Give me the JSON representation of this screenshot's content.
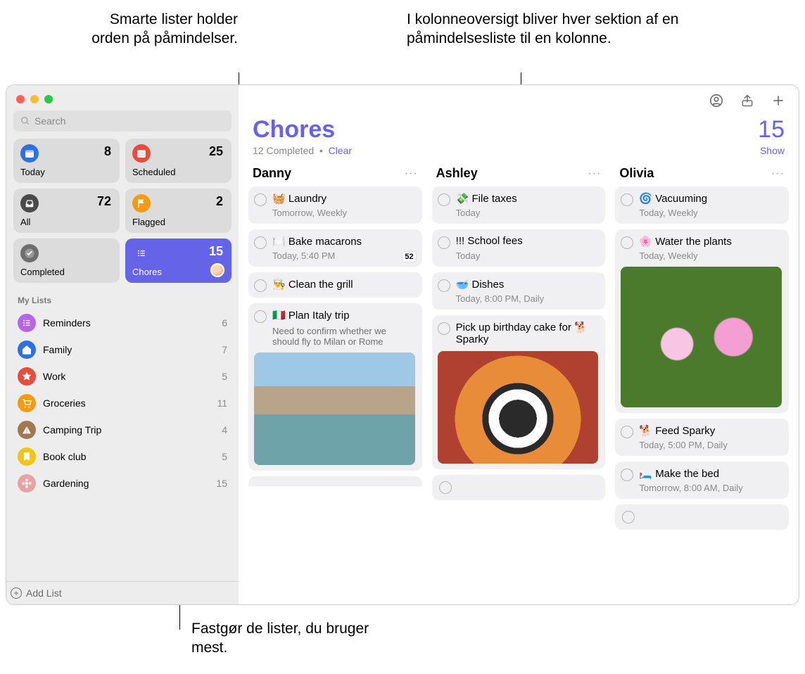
{
  "callouts": {
    "topLeft": "Smarte lister holder orden på påmindelser.",
    "topRight": "I kolonneoversigt bliver hver sektion af en påmindelsesliste til en kolonne.",
    "bottom": "Fastgør de lister, du bruger mest."
  },
  "search": {
    "placeholder": "Search"
  },
  "smartLists": [
    {
      "id": "today",
      "label": "Today",
      "count": "8",
      "color": "#2f6fe4",
      "icon": "calendar"
    },
    {
      "id": "scheduled",
      "label": "Scheduled",
      "count": "25",
      "color": "#e74c3c",
      "icon": "calendar-grid"
    },
    {
      "id": "all",
      "label": "All",
      "count": "72",
      "color": "#4a4a4a",
      "icon": "tray"
    },
    {
      "id": "flagged",
      "label": "Flagged",
      "count": "2",
      "color": "#f39c12",
      "icon": "flag"
    },
    {
      "id": "completed",
      "label": "Completed",
      "count": "",
      "color": "#6e6e6e",
      "icon": "check"
    },
    {
      "id": "chores",
      "label": "Chores",
      "count": "15",
      "color": "#6563e8",
      "icon": "list",
      "active": true,
      "avatar": true
    }
  ],
  "myListsHeader": "My Lists",
  "myLists": [
    {
      "name": "Reminders",
      "count": "6",
      "color": "#b863e8",
      "icon": "list"
    },
    {
      "name": "Family",
      "count": "7",
      "color": "#2f6fe4",
      "icon": "home"
    },
    {
      "name": "Work",
      "count": "5",
      "color": "#e74c3c",
      "icon": "star"
    },
    {
      "name": "Groceries",
      "count": "11",
      "color": "#f39c12",
      "icon": "cart"
    },
    {
      "name": "Camping Trip",
      "count": "4",
      "color": "#a17850",
      "icon": "tent"
    },
    {
      "name": "Book club",
      "count": "5",
      "color": "#f3c412",
      "icon": "bookmark"
    },
    {
      "name": "Gardening",
      "count": "15",
      "color": "#e7a3a3",
      "icon": "flower"
    }
  ],
  "addList": "Add List",
  "main": {
    "title": "Chores",
    "count": "15",
    "completed": "12 Completed",
    "clear": "Clear",
    "show": "Show"
  },
  "columns": [
    {
      "name": "Danny",
      "items": [
        {
          "title": "🧺 Laundry",
          "sub": "Tomorrow, Weekly"
        },
        {
          "title": "🍽️ Bake macarons",
          "sub": "Today, 5:40 PM",
          "badge": "52"
        },
        {
          "title": "👨‍🍳 Clean the grill"
        },
        {
          "title": "🇮🇹 Plan Italy trip",
          "note": "Need to confirm whether we should fly to Milan or Rome",
          "img": "italy"
        }
      ],
      "peek": true
    },
    {
      "name": "Ashley",
      "items": [
        {
          "title": "💸 File taxes",
          "sub": "Today"
        },
        {
          "title": "!!! School fees",
          "sub": "Today"
        },
        {
          "title": "🥣 Dishes",
          "sub": "Today, 8:00 PM, Daily"
        },
        {
          "title": "Pick up birthday cake for 🐕 Sparky",
          "img": "dog"
        }
      ],
      "empty": true
    },
    {
      "name": "Olivia",
      "items": [
        {
          "title": "🌀 Vacuuming",
          "sub": "Today, Weekly"
        },
        {
          "title": "🌸 Water the plants",
          "sub": "Today, Weekly",
          "img": "flower",
          "imgTall": true
        },
        {
          "title": "🐕 Feed Sparky",
          "sub": "Today, 5:00 PM, Daily"
        },
        {
          "title": "🛏️ Make the bed",
          "sub": "Tomorrow, 8:00 AM, Daily"
        }
      ],
      "empty": true
    }
  ]
}
